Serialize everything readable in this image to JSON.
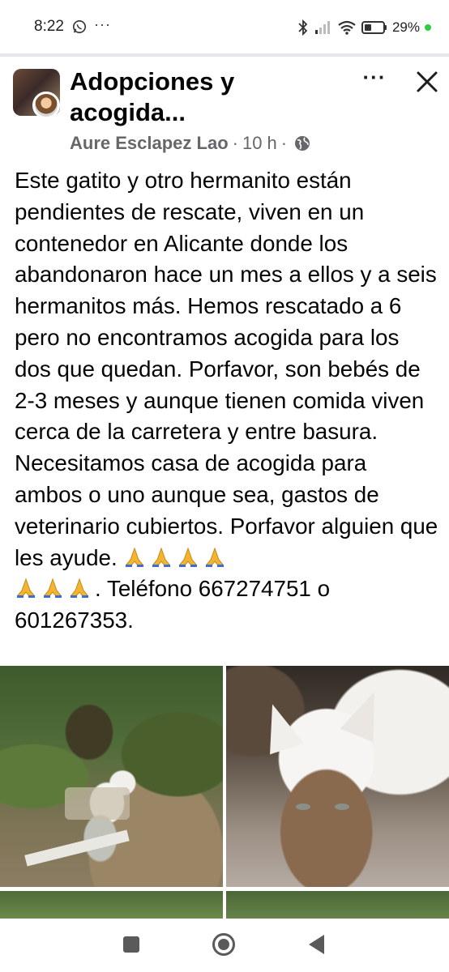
{
  "status_bar": {
    "time": "8:22",
    "more": "···",
    "battery": "29%",
    "icons": [
      "whatsapp-icon",
      "bluetooth-icon",
      "signal-icon",
      "wifi-icon",
      "battery-icon",
      "dot-icon"
    ],
    "dot_color": "#2ecc40"
  },
  "post": {
    "group_title": "Adopciones y acogida...",
    "more_label": "···",
    "author": "Aure Esclapez Lao",
    "separator": "·",
    "time_ago": "10 h",
    "audience_icon": "globe-icon",
    "body_lines": {
      "p1": "Este gatito y otro hermanito están pendientes de rescate, viven en un contenedor en Alicante donde los abandonaron hace un mes a ellos y a seis hermanitos más. Hemos rescatado a 6 pero no encontramos acogida para los dos que quedan. Porfavor, son bebés de 2-3 meses y aunque tienen comida viven cerca de la carretera y entre basura. Necesitamos casa de acogida para ambos o uno aunque sea, gastos de veterinario cubiertos. Porfavor alguien que les ayude.",
      "p2": ". Teléfono 667274751 o 601267353."
    },
    "emoji": "folded-hands-icon",
    "photos": [
      "photo-1",
      "photo-2",
      "photo-3",
      "photo-4"
    ]
  },
  "nav_bar": {
    "icons": [
      "recents-icon",
      "home-icon",
      "back-icon"
    ]
  },
  "colors": {
    "text": "#050505",
    "meta": "#65676b",
    "divider": "#e4e6eb"
  }
}
